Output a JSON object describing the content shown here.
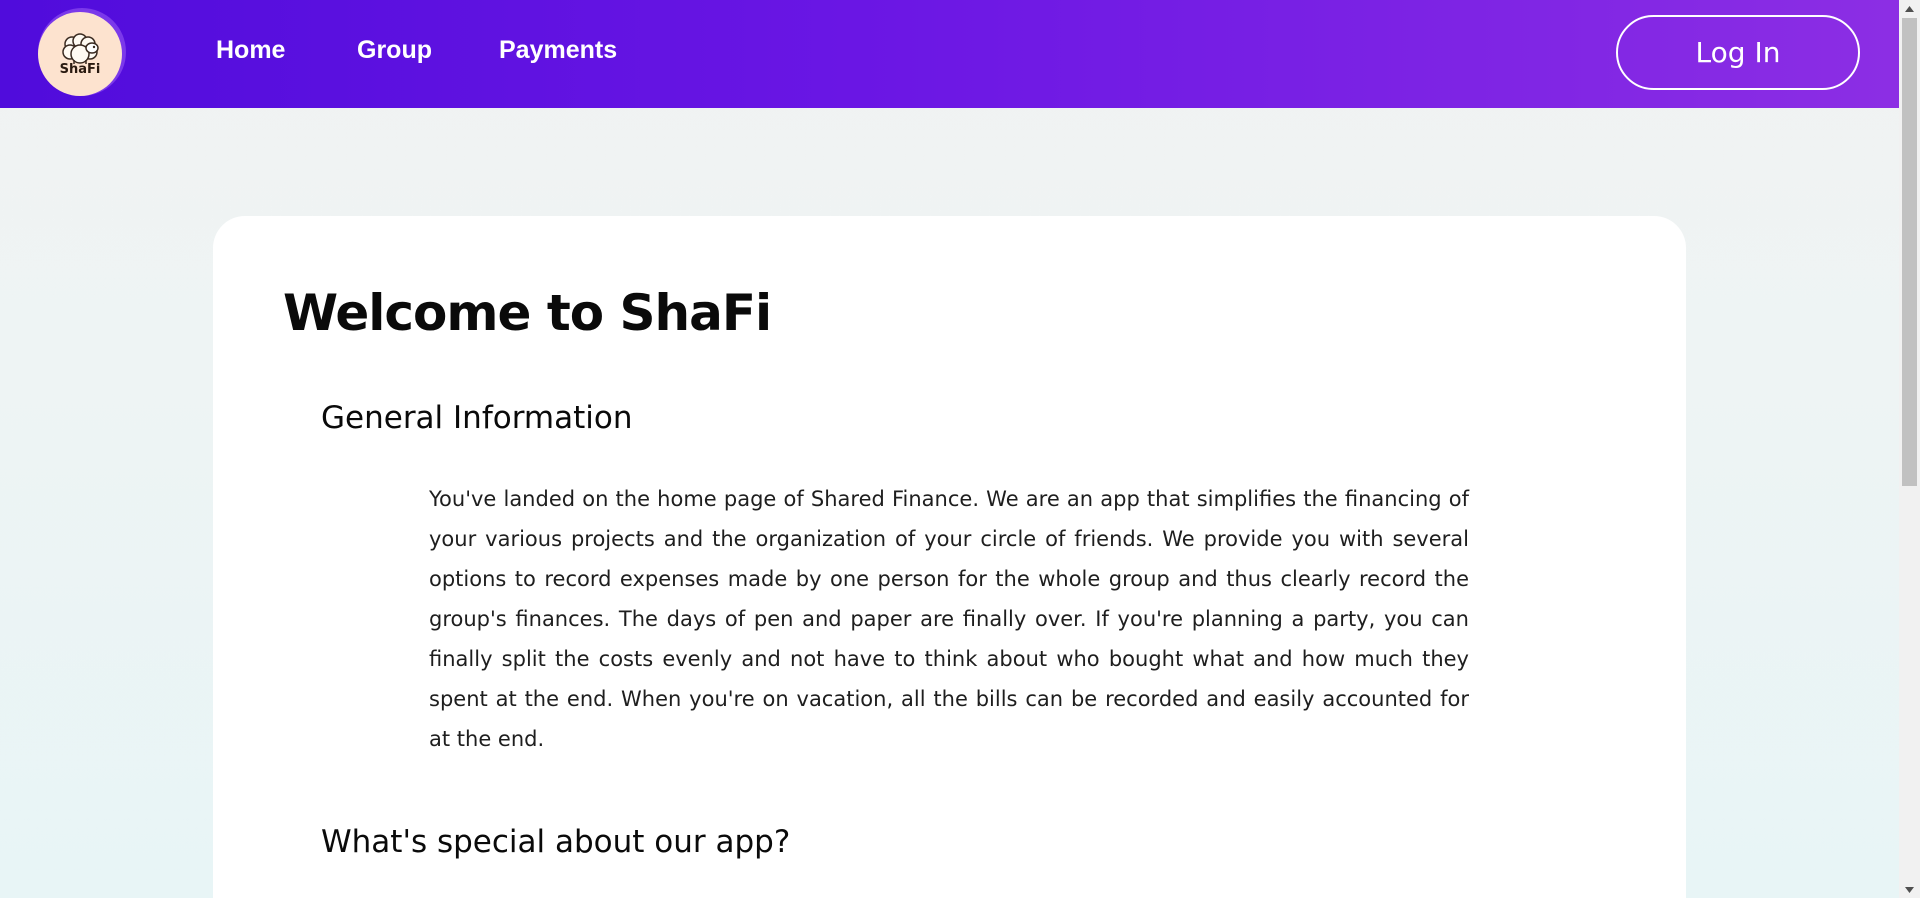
{
  "app": {
    "logo_text": "ShaFi"
  },
  "nav": {
    "items": [
      {
        "label": "Home"
      },
      {
        "label": "Group"
      },
      {
        "label": "Payments"
      }
    ],
    "login_label": "Log In"
  },
  "main": {
    "title": "Welcome to ShaFi",
    "sections": [
      {
        "heading": "General Information",
        "body": "You've landed on the home page of Shared Finance. We are an app that simplifies the financing of your various projects and the organization of your circle of friends. We provide you with several options to record expenses made by one person for the whole group and thus clearly record the group's finances. The days of pen and paper are finally over. If you're planning a party, you can finally split the costs evenly and not have to think about who bought what and how much they spent at the end. When you're on vacation, all the bills can be recorded and easily accounted for at the end."
      },
      {
        "heading": "What's special about our app?"
      }
    ]
  },
  "colors": {
    "nav_gradient_start": "#500cdc",
    "nav_gradient_end": "#8c2ee4",
    "logo_bg": "#fde3cf",
    "card_bg": "#ffffff",
    "page_bg": "#eef4f4"
  },
  "icons": {
    "logo": "sheep-icon",
    "scroll_up": "scroll-up-arrow-icon",
    "scroll_down": "scroll-down-arrow-icon"
  }
}
